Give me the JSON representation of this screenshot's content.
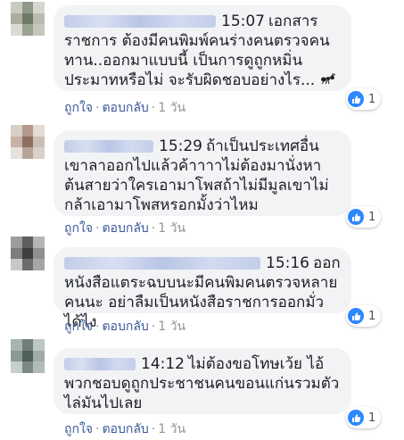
{
  "comments": [
    {
      "time": "15:07",
      "text": "เอกสารราชการ ต้องมีคนพิมพ์คนร่างคนตรวจคนทาน..ออกมาแบบนี้ เป็นการดูถูกหมิ่นประมาทหรือไม่ จะรับผิดชอบอย่างไร...",
      "likes": "1",
      "like_label": "ถูกใจ",
      "reply_label": "ตอบกลับ",
      "age": "1 วัน"
    },
    {
      "time": "15:29",
      "text": "ถ้าเป็นประเทศอื่นเขาลาออกไปแล้วค้าาาาไม่ต้องมานั่งหาต้นสายว่าใครเอามาโพสถ้าไม่มีมูลเขาไม่กล้าเอามาโพสหรอกมั้งว่าไหม",
      "likes": "1",
      "like_label": "ถูกใจ",
      "reply_label": "ตอบกลับ",
      "age": "1 วัน"
    },
    {
      "time": "15:16",
      "text": "ออกหนังสือแตระฉบบนะมีคนพิมคนตรวจหลายคนนะ อย่าลืมเป็นหนังสือราชการออกมั่วได้ไง",
      "likes": "1",
      "like_label": "ถูกใจ",
      "reply_label": "ตอบกลับ",
      "age": "1 วัน"
    },
    {
      "time": "14:12",
      "text": "ไม่ต้องขอโทษเว้ย ไอ้พวกชอบดูถูกประชาชนคนขอนแก่นรวมตัวไล่มันไปเลย",
      "likes": "1",
      "like_label": "ถูกใจ",
      "reply_label": "ตอบกลับ",
      "age": "1 วัน"
    }
  ],
  "icons": {
    "like": "thumbs-up-icon",
    "bug": "ant-icon"
  },
  "colors": {
    "like_blue": "#2d88ff",
    "link": "#385898",
    "bubble": "#f2f3f5"
  }
}
